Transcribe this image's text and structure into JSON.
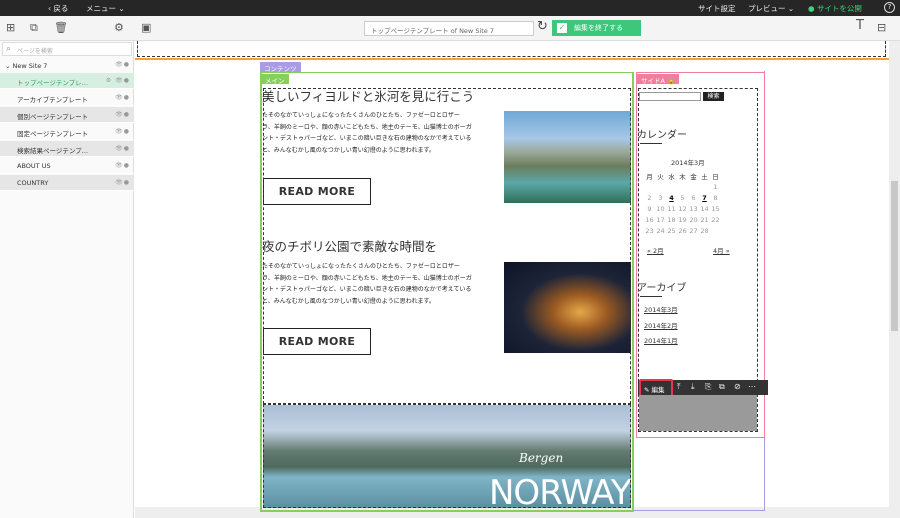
{
  "topbar": {
    "back": "‹ 戻る",
    "menu": "メニュー ⌄",
    "site_settings": "サイト設定",
    "preview": "プレビュー ⌄",
    "publish": "サイトを公開",
    "help": "?"
  },
  "toolbar": {
    "url": "トップページテンプレート of New Site 7",
    "end_edit": "編集を終了する"
  },
  "sidebar": {
    "search_placeholder": "ページを検索",
    "site": "New Site 7",
    "pages": [
      "トップページテンプレ…",
      "アーカイブテンプレート",
      "個別ページテンプレート",
      "固定ページテンプレート",
      "検索結果ページテンプ…",
      "ABOUT US",
      "COUNTRY"
    ]
  },
  "regions": {
    "contents": "コンテンツ",
    "main": "メイン",
    "side_a": "サイドA"
  },
  "articles": [
    {
      "title": "美しいフィヨルドと氷河を見に行こう",
      "lines": [
        "たそのなかていっしょになったたくさんのひとたち、ファゼーロとロザー",
        "ラ、羊飼のミーロや、顔の赤いこどもたち、地主のテーモ、山猫博士のボーガ",
        "ント・デストゥパーゴなど、いまこの暗い巨きな石の建物のなかで考えている",
        "と、みんなむかし風のなつかしい青い幻燈のように思われます。"
      ],
      "more": "READ MORE"
    },
    {
      "title": "夜のチボリ公園で素敵な時間を",
      "lines": [
        "たそのなかていっしょになったたくさんのひとたち、ファゼーロとロザー",
        "ラ、羊飼のミーロや、顔の赤いこどもたち、地主のテーモ、山猫博士のボーガ",
        "ント・デストゥパーゴなど、いまこの暗い巨きな石の建物のなかで考えている",
        "と、みんなむかし風のなつかしい青い幻燈のように思われます。"
      ],
      "more": "READ MORE"
    }
  ],
  "banner": {
    "city": "Bergen",
    "country": "NORWAY"
  },
  "side": {
    "search_btn": "検索",
    "calendar_title": "カレンダー",
    "month": "2014年3月",
    "weekdays": [
      "月",
      "火",
      "水",
      "木",
      "金",
      "土",
      "日"
    ],
    "weeks": [
      [
        "",
        "",
        "",
        "",
        "",
        "",
        "1"
      ],
      [
        "2",
        "3",
        "4",
        "5",
        "6",
        "7",
        "8"
      ],
      [
        "9",
        "10",
        "11",
        "12",
        "13",
        "14",
        "15"
      ],
      [
        "16",
        "17",
        "18",
        "19",
        "20",
        "21",
        "22"
      ],
      [
        "23",
        "24",
        "25",
        "26",
        "27",
        "28",
        ""
      ]
    ],
    "prev": "« 2月",
    "next": "4月 »",
    "archive_title": "アーカイブ",
    "archives": [
      "2014年3月",
      "2014年2月",
      "2014年1月"
    ],
    "edit": "編集"
  }
}
